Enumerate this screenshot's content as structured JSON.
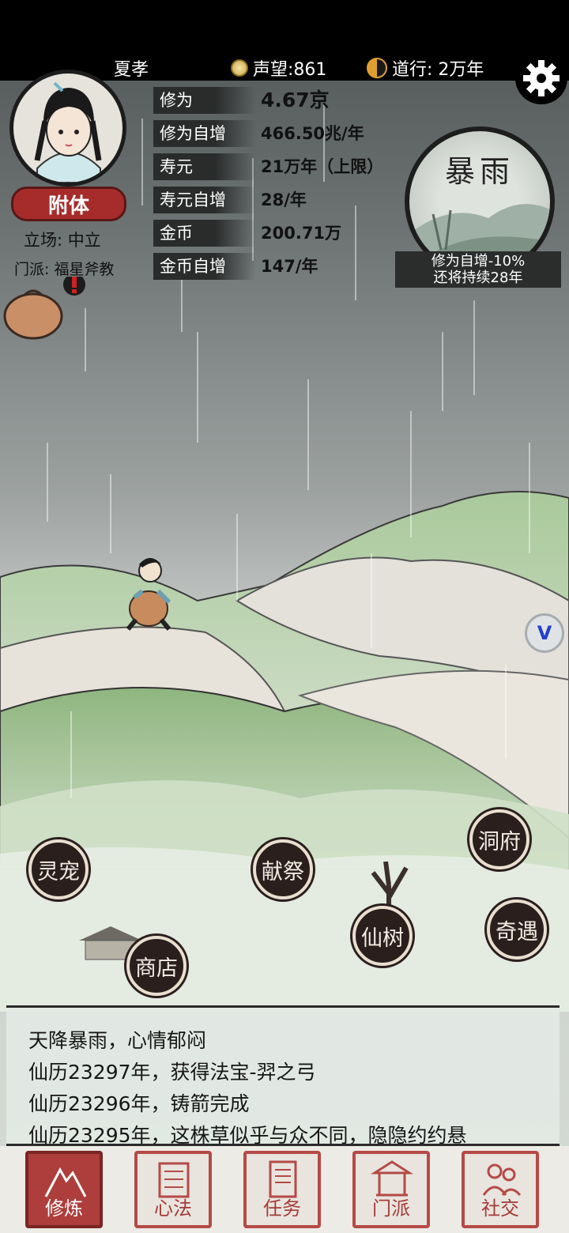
{
  "topbar": {
    "player_name": "夏孝",
    "reputation": "声望:861",
    "dao_practice": "道行: 2万年"
  },
  "profile": {
    "attach_button": "附体",
    "stance": "立场: 中立",
    "sect": "门派: 福星斧教"
  },
  "stats": [
    {
      "label": "修为",
      "value": "4.67京"
    },
    {
      "label": "修为自增",
      "value": "466.50兆/年"
    },
    {
      "label": "寿元",
      "value": "21万年（上限）"
    },
    {
      "label": "寿元自增",
      "value": "28/年"
    },
    {
      "label": "金币",
      "value": "200.71万"
    },
    {
      "label": "金币自增",
      "value": "147/年"
    }
  ],
  "weather": {
    "title": "暴雨",
    "effect": "修为自增-10%",
    "duration": "还将持续28年"
  },
  "map_buttons": {
    "spirit_pet": "灵宠",
    "offering": "献祭",
    "cave": "洞府",
    "immortal_tree": "仙树",
    "encounter": "奇遇",
    "shop": "商店"
  },
  "floating_button": "V",
  "log": [
    "天降暴雨，心情郁闷",
    "仙历23297年，获得法宝-羿之弓",
    "仙历23296年，铸箭完成",
    "仙历23295年，这株草似乎与众不同，隐隐约约悬"
  ],
  "bottom_nav": [
    {
      "label": "修炼",
      "active": true
    },
    {
      "label": "心法",
      "active": false
    },
    {
      "label": "任务",
      "active": false
    },
    {
      "label": "门派",
      "active": false
    },
    {
      "label": "社交",
      "active": false
    }
  ],
  "colors": {
    "accent_red": "#ad3e3b",
    "ink": "#1c1c1c",
    "hill_green": "#9cc08e"
  }
}
